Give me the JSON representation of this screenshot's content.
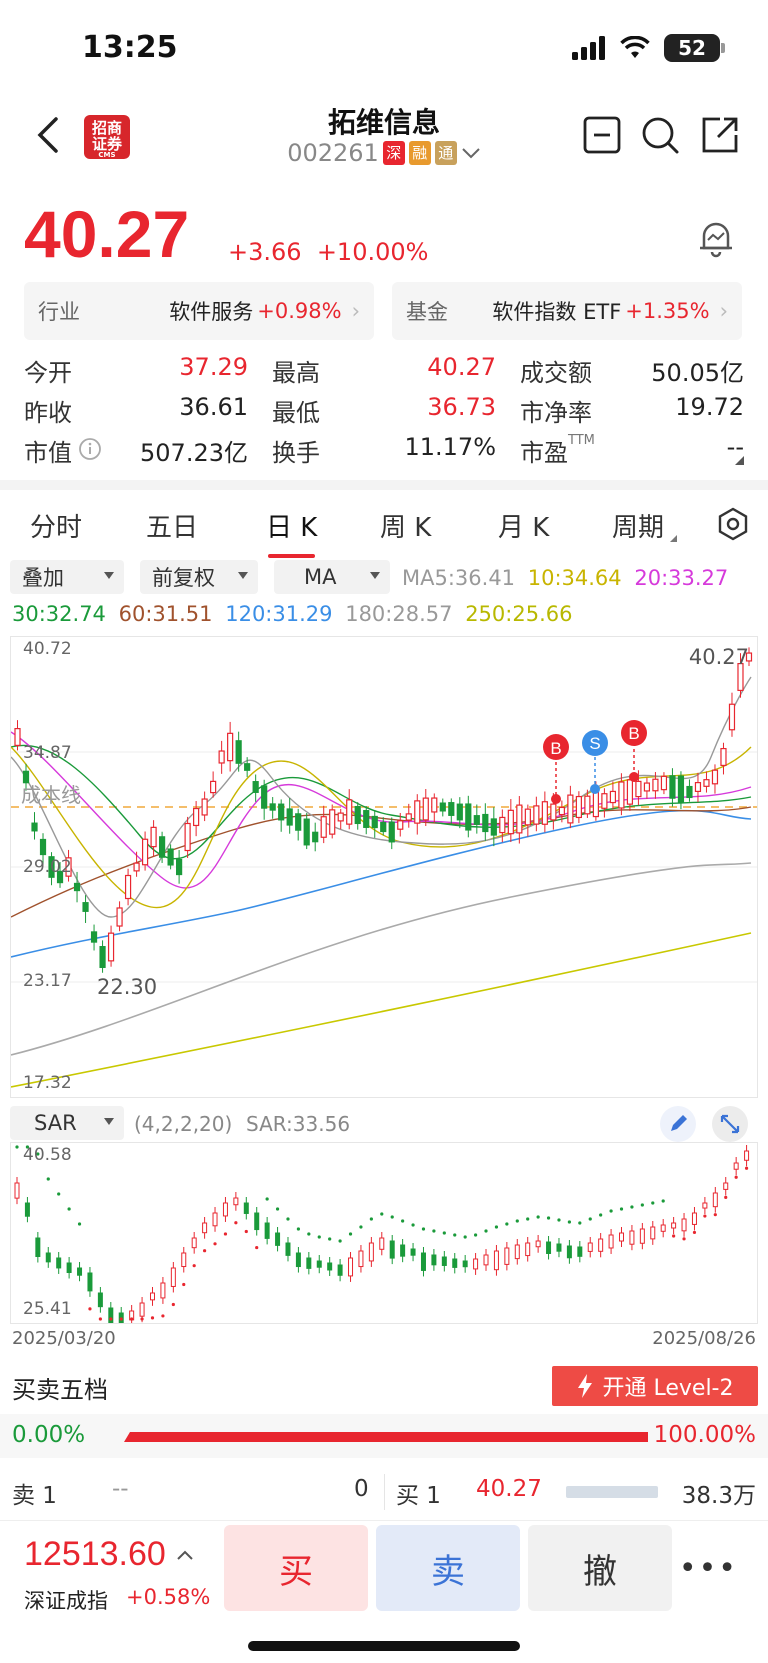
{
  "status_bar": {
    "time": "13:25",
    "battery": "52"
  },
  "header": {
    "logo_text": "招商证券",
    "logo_sub": "CMS",
    "stock_name": "拓维信息",
    "stock_code": "002261",
    "tags": [
      {
        "text": "深",
        "color": "#e8262f"
      },
      {
        "text": "融",
        "color": "#e89a2e"
      },
      {
        "text": "通",
        "color": "#c8a15c"
      }
    ]
  },
  "quote": {
    "price": "40.27",
    "change": "+3.66",
    "change_pct": "+10.00%"
  },
  "sectors": [
    {
      "label": "行业",
      "name": "软件服务",
      "pct": "+0.98%"
    },
    {
      "label": "基金",
      "name": "软件指数 ETF",
      "pct": "+1.35%"
    }
  ],
  "stats": [
    [
      {
        "k": "今开",
        "v": "37.29",
        "c": "red"
      },
      {
        "k": "最高",
        "v": "40.27",
        "c": "red"
      },
      {
        "k": "成交额",
        "v": "50.05亿",
        "c": ""
      }
    ],
    [
      {
        "k": "昨收",
        "v": "36.61",
        "c": ""
      },
      {
        "k": "最低",
        "v": "36.73",
        "c": "red"
      },
      {
        "k": "市净率",
        "v": "19.72",
        "c": ""
      }
    ],
    [
      {
        "k": "市值",
        "v": "507.23亿",
        "c": ""
      },
      {
        "k": "换手",
        "v": "11.17%",
        "c": ""
      },
      {
        "k": "市盈",
        "v": "--",
        "c": "",
        "sup": "TTM"
      }
    ]
  ],
  "tabs": [
    "分时",
    "五日",
    "日 K",
    "周 K",
    "月 K",
    "周期"
  ],
  "active_tab": "日 K",
  "chart_controls": {
    "overlay": "叠加",
    "adjust": "前复权",
    "indicator": "MA",
    "sar_indicator": "SAR"
  },
  "ma_values": [
    {
      "label": "MA5:",
      "value": "36.41",
      "color": "#999999"
    },
    {
      "label": "10:",
      "value": "34.64",
      "color": "#c8b400"
    },
    {
      "label": "20:",
      "value": "33.27",
      "color": "#d63adb"
    },
    {
      "label": "30:",
      "value": "32.74",
      "color": "#1a9a3a"
    },
    {
      "label": "60:",
      "value": "31.51",
      "color": "#a0522d"
    },
    {
      "label": "120:",
      "value": "31.29",
      "color": "#3a8ee6"
    },
    {
      "label": "180:",
      "value": "28.57",
      "color": "#999999"
    },
    {
      "label": "250:",
      "value": "25.66",
      "color": "#b8b800"
    }
  ],
  "kline": {
    "y_labels": [
      "40.72",
      "34.87",
      "29.02",
      "23.17",
      "17.32"
    ],
    "max_label": "40.27",
    "min_label": "22.30",
    "cost_line_label": "成本线",
    "markers": [
      "B",
      "S",
      "B"
    ]
  },
  "sar": {
    "params": "(4,2,2,20)",
    "value_label": "SAR:",
    "value": "33.56",
    "y_labels": [
      "40.58",
      "25.41"
    ]
  },
  "dates": {
    "start": "2025/03/20",
    "end": "2025/08/26"
  },
  "order_book": {
    "title": "买卖五档",
    "level2_button": "开通 Level-2",
    "sell_ratio": "0.00%",
    "buy_ratio": "100.00%",
    "sell1_label": "卖 1",
    "sell1_price": "--",
    "sell1_vol": "0",
    "buy1_label": "买 1",
    "buy1_price": "40.27",
    "buy1_vol": "38.3万"
  },
  "bottom": {
    "index_value": "12513.60",
    "index_name": "深证成指",
    "index_pct": "+0.58%",
    "buy": "买",
    "sell": "卖",
    "cancel": "撤",
    "more": "•••"
  }
}
